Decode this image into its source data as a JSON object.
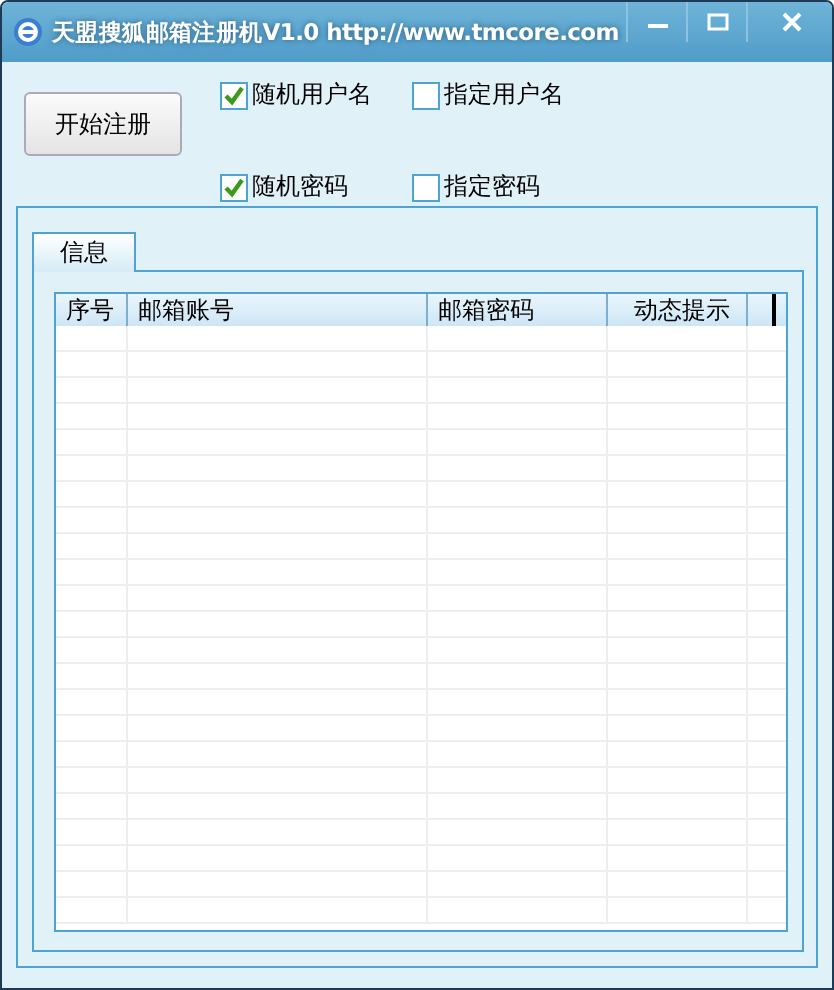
{
  "window": {
    "title": "天盟搜狐邮箱注册机V1.0 http://www.tmcore.com"
  },
  "start_button": {
    "label": "开始注册"
  },
  "options": [
    {
      "label": "随机用户名",
      "checked": true
    },
    {
      "label": "指定用户名",
      "checked": false
    },
    {
      "label": "随机密码",
      "checked": true
    },
    {
      "label": "指定密码",
      "checked": false
    }
  ],
  "tabs": [
    {
      "label": "信息",
      "selected": true
    }
  ],
  "table": {
    "columns": [
      "序号",
      "邮箱账号",
      "邮箱密码",
      "动态提示"
    ]
  }
}
